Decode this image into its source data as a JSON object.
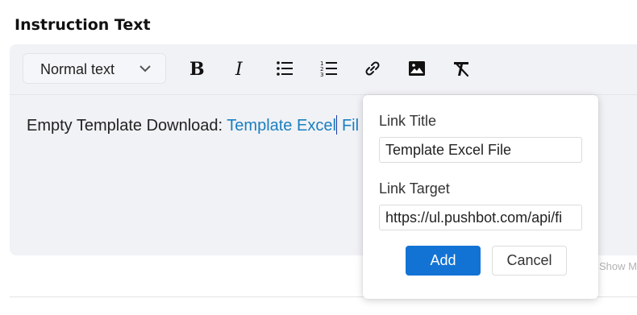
{
  "section": {
    "title": "Instruction Text"
  },
  "toolbar": {
    "block_type": "Normal text",
    "icons": [
      "bold-icon",
      "italic-icon",
      "bulleted-list-icon",
      "numbered-list-icon",
      "link-icon",
      "image-icon",
      "clear-formatting-icon"
    ]
  },
  "content": {
    "prefix": "Empty Template Download: ",
    "link_before_caret": "Template Excel",
    "link_after_caret": " Fil"
  },
  "footer": {
    "show_more": "Show M"
  },
  "link_popover": {
    "title_label": "Link Title",
    "title_value": "Template Excel File",
    "target_label": "Link Target",
    "target_value": "https://ul.pushbot.com/api/fi",
    "add_label": "Add",
    "cancel_label": "Cancel"
  },
  "colors": {
    "link": "#1a7fc0",
    "primary_button": "#1273d4",
    "editor_background": "#f1f2f6"
  }
}
